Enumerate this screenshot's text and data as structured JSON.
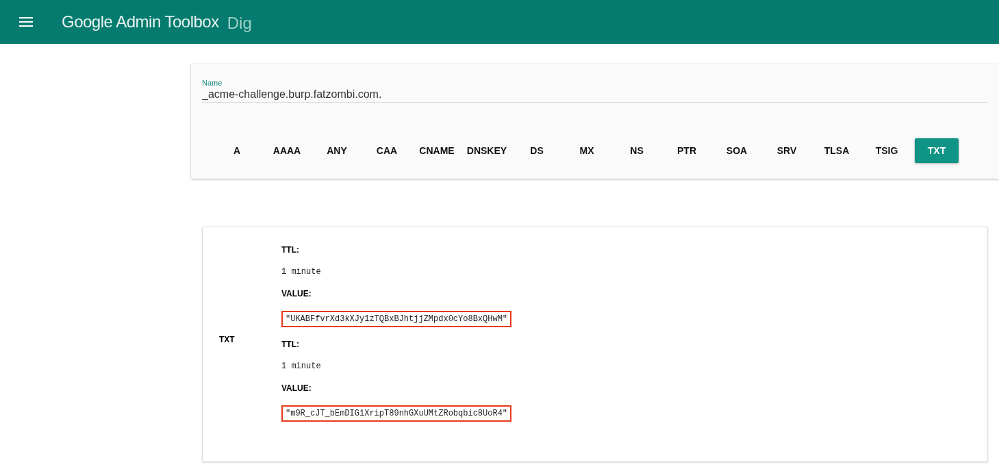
{
  "app_bar": {
    "title": "Google Admin Toolbox",
    "subtitle": "Dig"
  },
  "query": {
    "label": "Name",
    "value": "_acme-challenge.burp.fatzombi.com."
  },
  "record_types": [
    {
      "label": "A",
      "selected": false
    },
    {
      "label": "AAAA",
      "selected": false
    },
    {
      "label": "ANY",
      "selected": false
    },
    {
      "label": "CAA",
      "selected": false
    },
    {
      "label": "CNAME",
      "selected": false
    },
    {
      "label": "DNSKEY",
      "selected": false
    },
    {
      "label": "DS",
      "selected": false
    },
    {
      "label": "MX",
      "selected": false
    },
    {
      "label": "NS",
      "selected": false
    },
    {
      "label": "PTR",
      "selected": false
    },
    {
      "label": "SOA",
      "selected": false
    },
    {
      "label": "SRV",
      "selected": false
    },
    {
      "label": "TLSA",
      "selected": false
    },
    {
      "label": "TSIG",
      "selected": false
    },
    {
      "label": "TXT",
      "selected": true
    }
  ],
  "results": {
    "type": "TXT",
    "records": [
      {
        "ttl_label": "TTL:",
        "ttl": "1 minute",
        "value_label": "VALUE:",
        "value": "\"UKABFfvrXd3kXJy1zTQBxBJhtjjZMpdx0cYo8BxQHwM\"",
        "highlighted": true
      },
      {
        "ttl_label": "TTL:",
        "ttl": "1 minute",
        "value_label": "VALUE:",
        "value": "\"m9R_cJT_bEmDIG1XripT89nhGXuUMtZRobqbic8UoR4\"",
        "highlighted": true
      }
    ]
  }
}
